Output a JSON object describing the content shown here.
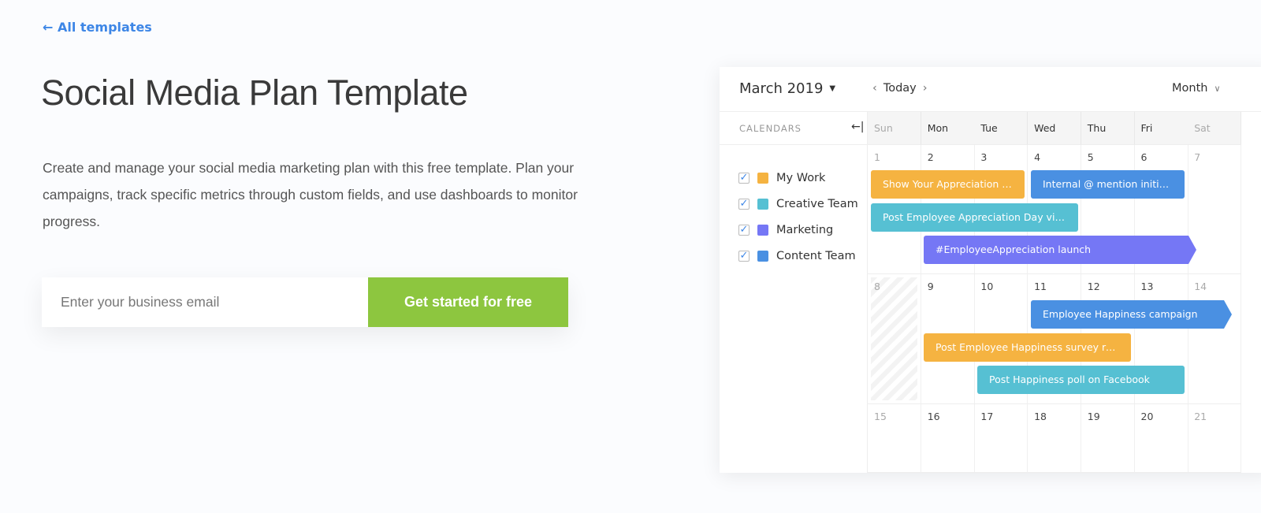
{
  "back_link": "← All templates",
  "title": "Social Media Plan Template",
  "description": "Create and manage your social media marketing plan with this free template. Plan your campaigns, track specific metrics through custom fields, and use dashboards to monitor progress.",
  "form": {
    "email_placeholder": "Enter your business email",
    "submit_label": "Get started for free"
  },
  "colors": {
    "accent": "#3d86e6",
    "cta": "#8dc63f",
    "orange": "#f5b341",
    "teal": "#56c0d3",
    "purple": "#7577f5",
    "blue": "#4a90e2"
  },
  "calendar": {
    "month": "March 2019",
    "today": "Today",
    "view": "Month",
    "sidebar_title": "CALENDARS",
    "calendars": [
      {
        "label": "My Work",
        "color": "#f5b341",
        "checked": true
      },
      {
        "label": "Creative Team",
        "color": "#56c0d3",
        "checked": true
      },
      {
        "label": "Marketing",
        "color": "#7577f5",
        "checked": true
      },
      {
        "label": "Content Team",
        "color": "#4a90e2",
        "checked": true
      }
    ],
    "weekdays": [
      "Sun",
      "Mon",
      "Tue",
      "Wed",
      "Thu",
      "Fri",
      "Sat"
    ],
    "weeks": [
      [
        "1",
        "2",
        "3",
        "4",
        "5",
        "6",
        "7"
      ],
      [
        "8",
        "9",
        "10",
        "11",
        "12",
        "13",
        "14"
      ],
      [
        "15",
        "16",
        "17",
        "18",
        "19",
        "20",
        "21"
      ]
    ],
    "events": [
      {
        "title": "Show Your Appreciation cam...",
        "color": "#f5b341"
      },
      {
        "title": "Internal @ mention initiative",
        "color": "#4a90e2"
      },
      {
        "title": "Post Employee Appreciation Day video",
        "color": "#56c0d3"
      },
      {
        "title": "#EmployeeAppreciation launch",
        "color": "#7577f5"
      },
      {
        "title": "Employee Happiness campaign",
        "color": "#4a90e2"
      },
      {
        "title": "Post Employee Happiness survey results",
        "color": "#f5b341"
      },
      {
        "title": "Post Happiness poll on Facebook",
        "color": "#56c0d3"
      }
    ]
  }
}
